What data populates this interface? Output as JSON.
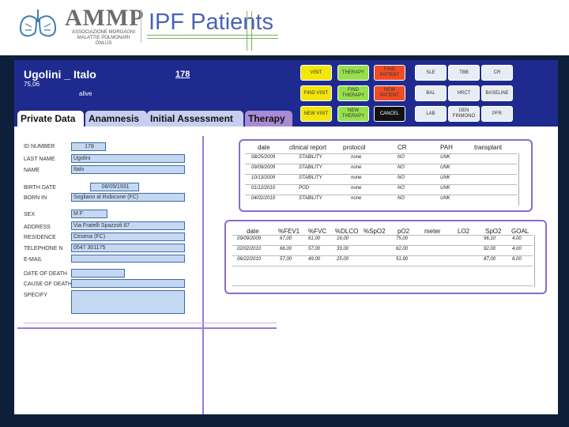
{
  "header": {
    "logo_text": "AMMP",
    "logo_subtitle": "ASSOCIAZIONE MORGAGNI MALATTIE POLMONARI",
    "logo_subtitle2": "ONLUS",
    "title": "IPF Patients",
    "accent_color": "#7ab05a",
    "title_color": "#4a63b4"
  },
  "patient": {
    "name": "Ugolini _ Italo",
    "id": "178",
    "age": "75,06",
    "status": "alive"
  },
  "buttons": [
    {
      "label": "VISIT",
      "color": "yellow"
    },
    {
      "label": "THERAPY",
      "color": "green"
    },
    {
      "label": "FIND PATIENT",
      "color": "red"
    },
    {
      "label": "SLE",
      "color": "white"
    },
    {
      "label": "TBB",
      "color": "white"
    },
    {
      "label": "CR",
      "color": "white"
    },
    {
      "label": "FIND VISIT",
      "color": "yellow"
    },
    {
      "label": "FIND THERAPY",
      "color": "green"
    },
    {
      "label": "NEW PATIENT",
      "color": "red"
    },
    {
      "label": "BAL",
      "color": "white"
    },
    {
      "label": "HRCT",
      "color": "white"
    },
    {
      "label": "BASELINE",
      "color": "white"
    },
    {
      "label": "NEW VISIT",
      "color": "yellow"
    },
    {
      "label": "NEW THERAPY",
      "color": "green"
    },
    {
      "label": "CANCEL",
      "color": "black"
    },
    {
      "label": "LAB",
      "color": "white"
    },
    {
      "label": "GEN FINMONO",
      "color": "white"
    },
    {
      "label": "PFR",
      "color": "white"
    }
  ],
  "tabs": [
    {
      "label": "Private Data"
    },
    {
      "label": "Anamnesis"
    },
    {
      "label": "Initial Assessment"
    },
    {
      "label": "Therapy"
    }
  ],
  "form": {
    "fields": [
      {
        "label": "ID NUMBER",
        "value": "178"
      },
      {
        "label": "LAST NAME",
        "value": "Ugolini"
      },
      {
        "label": "NAME",
        "value": "Italo"
      },
      {
        "label": "BIRTH DATE",
        "value": "08/09/1931"
      },
      {
        "label": "BORN IN",
        "value": "Sogliano al Rubicone (FC)"
      },
      {
        "label": "SEX",
        "value": "M   F"
      },
      {
        "label": "ADDRESS",
        "value": "Via Fratelli Spazzoli 87"
      },
      {
        "label": "RESIDENCE",
        "value": "Cesena (FC)"
      },
      {
        "label": "TELEPHONE N",
        "value": "0547 301175"
      },
      {
        "label": "E-MAIL",
        "value": ""
      },
      {
        "label": "DATE OF DEATH",
        "value": ""
      },
      {
        "label": "CAUSE OF DEATH",
        "value": ""
      },
      {
        "label": "SPECIFY",
        "value": ""
      }
    ]
  },
  "visits_table": {
    "headers": [
      "date",
      "clinical report",
      "protocol",
      "CR",
      "PAH",
      "transplant"
    ],
    "rows": [
      [
        "08/25/2009",
        "STABILITY",
        "none",
        "NO",
        "UNK",
        ""
      ],
      [
        "09/09/2009",
        "STABILITY",
        "none",
        "NO",
        "UNK",
        ""
      ],
      [
        "10/13/2009",
        "STABILITY",
        "none",
        "NO",
        "UNK",
        ""
      ],
      [
        "01/12/2010",
        "POD",
        "none",
        "NO",
        "UNK",
        ""
      ],
      [
        "04/02/2010",
        "STABILITY",
        "none",
        "NO",
        "UNK",
        ""
      ]
    ]
  },
  "pft_table": {
    "headers": [
      "date",
      "%FEV1",
      "%FVC",
      "%DLCO",
      "%SpO2",
      "pO2",
      "meter",
      "LO2",
      "SpO2",
      "GOAL"
    ],
    "rows": [
      [
        "09/09/2009",
        "67,00",
        "61,00",
        "16,00",
        "",
        "75,00",
        "",
        "",
        "96,10",
        "4,00"
      ],
      [
        "02/02/2010",
        "66,00",
        "57,00",
        "33,00",
        "",
        "62,00",
        "",
        "",
        "92,00",
        "4,00"
      ],
      [
        "06/22/2010",
        "57,00",
        "49,00",
        "25,00",
        "",
        "51,90",
        "",
        "",
        "87,00",
        "6,00"
      ]
    ]
  }
}
